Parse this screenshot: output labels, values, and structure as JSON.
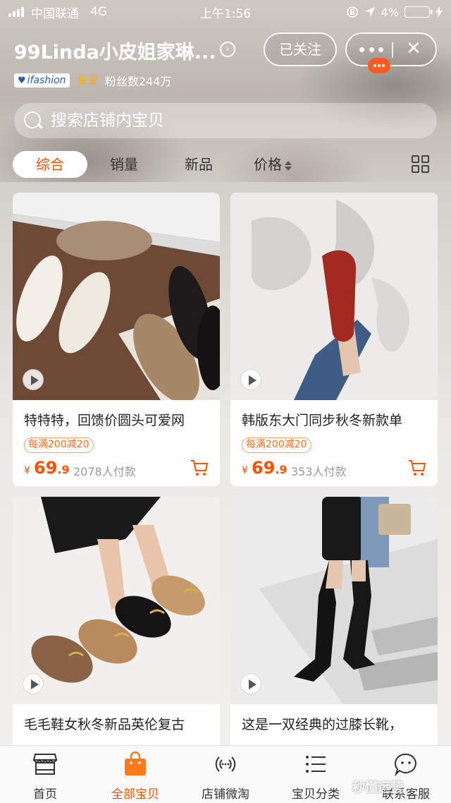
{
  "status_bar": {
    "carrier": "中国联通",
    "network": "4G",
    "time": "上午1:56",
    "battery": "4%",
    "battery_level": 0.04
  },
  "header": {
    "store_name": "99Linda小皮姐家琳...",
    "follow_label": "已关注",
    "brand_badge": "ifashion",
    "fans": "粉丝数244万"
  },
  "search": {
    "placeholder": "搜索店铺内宝贝"
  },
  "sort_tabs": [
    {
      "label": "综合",
      "active": true
    },
    {
      "label": "销量",
      "active": false
    },
    {
      "label": "新品",
      "active": false
    },
    {
      "label": "价格",
      "active": false
    }
  ],
  "products": [
    {
      "title": "特特特，回馈价圆头可爱网",
      "promo": "每满200减20",
      "price_symbol": "¥",
      "price_int": "69",
      "price_dec": ".9",
      "sold": "2078人付款"
    },
    {
      "title": "韩版东大门同步秋冬新款单",
      "promo": "每满200减20",
      "price_symbol": "¥",
      "price_int": "69",
      "price_dec": ".9",
      "sold": "353人付款"
    },
    {
      "title": "毛毛鞋女秋冬新品英伦复古"
    },
    {
      "title": "这是一双经典的过膝长靴，"
    }
  ],
  "tab_bar": [
    {
      "label": "首页",
      "icon": "shop-icon",
      "active": false
    },
    {
      "label": "全部宝贝",
      "icon": "shopping-bag-icon",
      "active": true
    },
    {
      "label": "店铺微淘",
      "icon": "broadcast-icon",
      "active": false
    },
    {
      "label": "宝贝分类",
      "icon": "list-icon",
      "active": false
    },
    {
      "label": "联系客服",
      "icon": "chat-icon",
      "active": false
    }
  ],
  "watermark": "秒懂运营",
  "colors": {
    "accent": "#ff5000",
    "promo_border": "#f0a070"
  }
}
